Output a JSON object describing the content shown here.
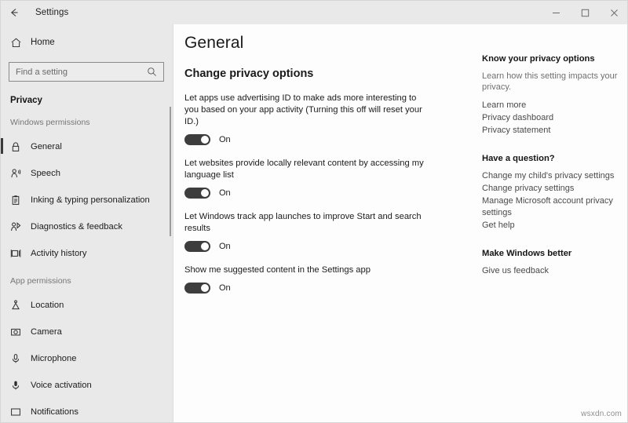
{
  "titlebar": {
    "back_icon": "back-arrow-icon",
    "app_title": "Settings",
    "minimize_label": "—",
    "maximize_label": "□",
    "close_label": "✕"
  },
  "sidebar": {
    "home_icon": "home-icon",
    "home_label": "Home",
    "search": {
      "placeholder": "Find a setting",
      "value": "",
      "icon": "search-icon"
    },
    "section_title": "Privacy",
    "groups": [
      {
        "title": "Windows permissions",
        "items": [
          {
            "label": "General",
            "icon": "lock-icon",
            "selected": true
          },
          {
            "label": "Speech",
            "icon": "speech-person-icon",
            "selected": false
          },
          {
            "label": "Inking & typing personalization",
            "icon": "clipboard-pen-icon",
            "selected": false
          },
          {
            "label": "Diagnostics & feedback",
            "icon": "diagnostics-person-icon",
            "selected": false
          },
          {
            "label": "Activity history",
            "icon": "activity-history-icon",
            "selected": false
          }
        ]
      },
      {
        "title": "App permissions",
        "items": [
          {
            "label": "Location",
            "icon": "location-pin-icon",
            "selected": false
          },
          {
            "label": "Camera",
            "icon": "camera-icon",
            "selected": false
          },
          {
            "label": "Microphone",
            "icon": "microphone-icon",
            "selected": false
          },
          {
            "label": "Voice activation",
            "icon": "voice-activation-icon",
            "selected": false
          },
          {
            "label": "Notifications",
            "icon": "notifications-icon",
            "selected": false
          }
        ]
      }
    ]
  },
  "main": {
    "page_title": "General",
    "section_title": "Change privacy options",
    "options": [
      {
        "label": "Let apps use advertising ID to make ads more interesting to you based on your app activity (Turning this off will reset your ID.)",
        "state": "On",
        "enabled": true
      },
      {
        "label": "Let websites provide locally relevant content by accessing my language list",
        "state": "On",
        "enabled": true
      },
      {
        "label": "Let Windows track app launches to improve Start and search results",
        "state": "On",
        "enabled": true
      },
      {
        "label": "Show me suggested content in the Settings app",
        "state": "On",
        "enabled": true
      }
    ]
  },
  "rail": {
    "blocks": [
      {
        "heading": "Know your privacy options",
        "description": "Learn how this setting impacts your privacy.",
        "links": [
          "Learn more",
          "Privacy dashboard",
          "Privacy statement"
        ]
      },
      {
        "heading": "Have a question?",
        "description": "",
        "links": [
          "Change my child's privacy settings",
          "Change privacy settings",
          "Manage Microsoft account privacy settings",
          "Get help"
        ]
      },
      {
        "heading": "Make Windows better",
        "description": "",
        "links": [
          "Give us feedback"
        ]
      }
    ]
  },
  "watermark": "wsxdn.com",
  "colors": {
    "sidebar_bg": "#e9e9e9",
    "content_bg": "#fdfdfd",
    "toggle_on": "#3d3d3d",
    "accent_selected": "#3a3a3a",
    "text_primary": "#1c1c1c",
    "text_muted": "#707070"
  }
}
